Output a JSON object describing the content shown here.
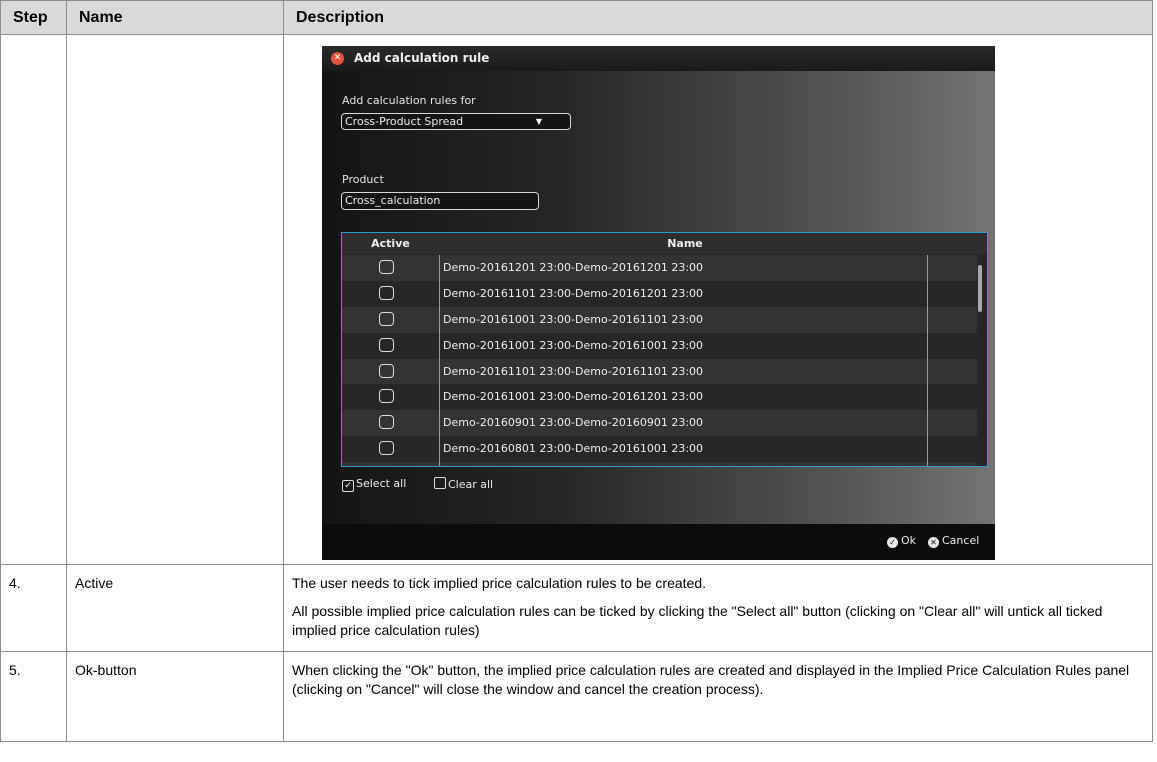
{
  "table": {
    "headers": {
      "step": "Step",
      "name": "Name",
      "description": "Description"
    },
    "rows": [
      {
        "step": "4.",
        "name": "Active",
        "desc": [
          "The user needs to tick implied price calculation rules to be created.",
          "All possible implied price calculation rules can be ticked by clicking the \"Select all\" button (clicking on \"Clear all\" will untick all ticked implied price calculation rules)"
        ]
      },
      {
        "step": "5.",
        "name": "Ok-button",
        "desc": [
          "When clicking the \"Ok\" button, the implied price calculation rules are created and displayed in the Implied Price Calculation Rules panel (clicking on \"Cancel\" will close the window and cancel the creation process)."
        ]
      }
    ]
  },
  "dialog": {
    "title": "Add calculation rule",
    "rules_for_label": "Add calculation rules for",
    "rules_for_value": "Cross-Product Spread",
    "product_label": "Product",
    "product_value": "Cross_calculation",
    "grid": {
      "columns": [
        "Active",
        "Name"
      ],
      "rows": [
        "Demo-20161201 23:00-Demo-20161201 23:00",
        "Demo-20161101 23:00-Demo-20161201 23:00",
        "Demo-20161001 23:00-Demo-20161101 23:00",
        "Demo-20161001 23:00-Demo-20161001 23:00",
        "Demo-20161101 23:00-Demo-20161101 23:00",
        "Demo-20161001 23:00-Demo-20161201 23:00",
        "Demo-20160901 23:00-Demo-20160901 23:00",
        "Demo-20160801 23:00-Demo-20161001 23:00"
      ]
    },
    "select_all": "Select all",
    "clear_all": "Clear all",
    "ok": "Ok",
    "cancel": "Cancel"
  }
}
